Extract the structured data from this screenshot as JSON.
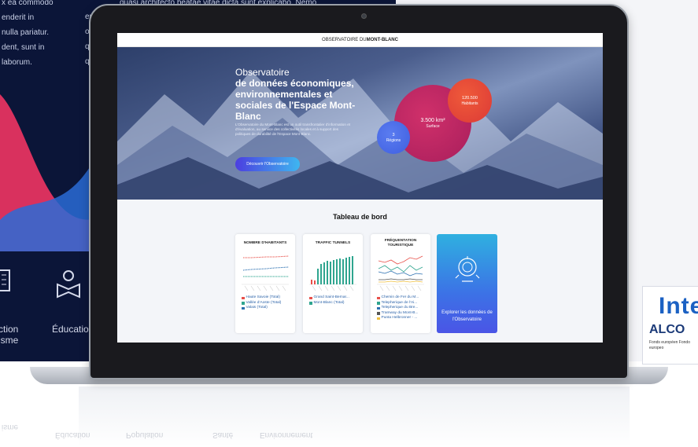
{
  "background": {
    "left_text_col1": [
      "x ea commodo",
      "enderit in",
      "nulla pariatur.",
      "dent, sunt in",
      " laborum."
    ],
    "left_text_col2": [
      "quasi architecto beatae vitae dicta sunt explicabo. Nemo",
      "en",
      "od",
      "qu",
      "qu"
    ],
    "icon_labels": {
      "action": "ction",
      "action2": "isme",
      "education": "Éducation"
    },
    "partner": {
      "big": "Inte",
      "small": "ALCO",
      "tiny": "Fonds européen\nFondo europeo"
    },
    "reflection_labels": [
      "Éducation",
      "Population",
      "Santé",
      "Environnement",
      "isme"
    ]
  },
  "screen": {
    "topbar": {
      "prefix": "OBSERVATOIRE DU ",
      "bold": "MONT-BLANC"
    },
    "hero": {
      "title_light": "Observatoire",
      "title_bold": "de données économiques, environnementales et sociales de l'Espace Mont-Blanc",
      "description": "L'Observatoire du Mont-Blanc est un outil transfrontalier d'information et d'évaluation, au service des collectivités locales et à support des politiques de durabilité de l'Espace Mont-Blanc.",
      "button": "Découvrir l'Observatoire",
      "bubbles": [
        {
          "num": "120.500",
          "label": "Habitants"
        },
        {
          "num": "3.500 km²",
          "label": "Surface"
        },
        {
          "num": "3",
          "label": "Régions"
        }
      ]
    },
    "dashboard": {
      "title": "Tableau de bord",
      "cards": [
        {
          "title": "NOMBRE D'HABITANTS",
          "legend": [
            {
              "label": "Haute Savoie (Total)",
              "color": "#e8504a"
            },
            {
              "label": "Vallée d'Aoste (Total)",
              "color": "#2fa58f"
            },
            {
              "label": "Valais (Total)",
              "color": "#2a6fb0"
            }
          ]
        },
        {
          "title": "TRAFFIC TUNNELS",
          "legend": [
            {
              "label": "Grand Saint-Bernar...",
              "color": "#e8504a"
            },
            {
              "label": "Mont-Blanc (Total)",
              "color": "#2fa58f"
            }
          ]
        },
        {
          "title": "FRÉQUENTATION TOURISTIQUE",
          "legend": [
            {
              "label": "Chemin de Fer du M...",
              "color": "#e8504a"
            },
            {
              "label": "Telepherique de l'Ai...",
              "color": "#2fa58f"
            },
            {
              "label": "Telepherique du Bre...",
              "color": "#2a6fb0"
            },
            {
              "label": "Tramway du Mont-B...",
              "color": "#555555"
            },
            {
              "label": "Punta Helbronner - ...",
              "color": "#f0c040"
            }
          ]
        }
      ],
      "explore": "Explorer les données de l'Observatoire"
    }
  }
}
